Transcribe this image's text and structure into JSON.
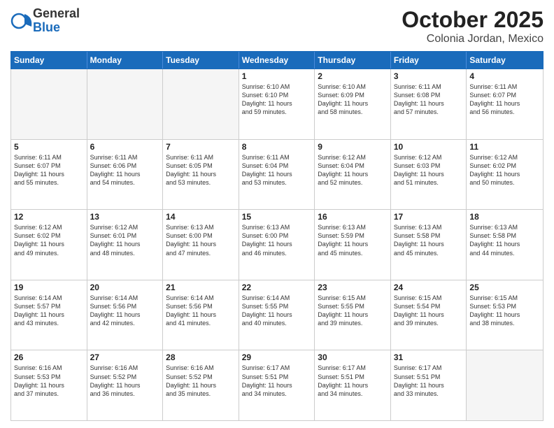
{
  "header": {
    "logo_general": "General",
    "logo_blue": "Blue",
    "month": "October 2025",
    "location": "Colonia Jordan, Mexico"
  },
  "weekdays": [
    "Sunday",
    "Monday",
    "Tuesday",
    "Wednesday",
    "Thursday",
    "Friday",
    "Saturday"
  ],
  "rows": [
    [
      {
        "day": "",
        "info": "",
        "empty": true
      },
      {
        "day": "",
        "info": "",
        "empty": true
      },
      {
        "day": "",
        "info": "",
        "empty": true
      },
      {
        "day": "1",
        "info": "Sunrise: 6:10 AM\nSunset: 6:10 PM\nDaylight: 11 hours\nand 59 minutes.",
        "empty": false
      },
      {
        "day": "2",
        "info": "Sunrise: 6:10 AM\nSunset: 6:09 PM\nDaylight: 11 hours\nand 58 minutes.",
        "empty": false
      },
      {
        "day": "3",
        "info": "Sunrise: 6:11 AM\nSunset: 6:08 PM\nDaylight: 11 hours\nand 57 minutes.",
        "empty": false
      },
      {
        "day": "4",
        "info": "Sunrise: 6:11 AM\nSunset: 6:07 PM\nDaylight: 11 hours\nand 56 minutes.",
        "empty": false
      }
    ],
    [
      {
        "day": "5",
        "info": "Sunrise: 6:11 AM\nSunset: 6:07 PM\nDaylight: 11 hours\nand 55 minutes.",
        "empty": false
      },
      {
        "day": "6",
        "info": "Sunrise: 6:11 AM\nSunset: 6:06 PM\nDaylight: 11 hours\nand 54 minutes.",
        "empty": false
      },
      {
        "day": "7",
        "info": "Sunrise: 6:11 AM\nSunset: 6:05 PM\nDaylight: 11 hours\nand 53 minutes.",
        "empty": false
      },
      {
        "day": "8",
        "info": "Sunrise: 6:11 AM\nSunset: 6:04 PM\nDaylight: 11 hours\nand 53 minutes.",
        "empty": false
      },
      {
        "day": "9",
        "info": "Sunrise: 6:12 AM\nSunset: 6:04 PM\nDaylight: 11 hours\nand 52 minutes.",
        "empty": false
      },
      {
        "day": "10",
        "info": "Sunrise: 6:12 AM\nSunset: 6:03 PM\nDaylight: 11 hours\nand 51 minutes.",
        "empty": false
      },
      {
        "day": "11",
        "info": "Sunrise: 6:12 AM\nSunset: 6:02 PM\nDaylight: 11 hours\nand 50 minutes.",
        "empty": false
      }
    ],
    [
      {
        "day": "12",
        "info": "Sunrise: 6:12 AM\nSunset: 6:02 PM\nDaylight: 11 hours\nand 49 minutes.",
        "empty": false
      },
      {
        "day": "13",
        "info": "Sunrise: 6:12 AM\nSunset: 6:01 PM\nDaylight: 11 hours\nand 48 minutes.",
        "empty": false
      },
      {
        "day": "14",
        "info": "Sunrise: 6:13 AM\nSunset: 6:00 PM\nDaylight: 11 hours\nand 47 minutes.",
        "empty": false
      },
      {
        "day": "15",
        "info": "Sunrise: 6:13 AM\nSunset: 6:00 PM\nDaylight: 11 hours\nand 46 minutes.",
        "empty": false
      },
      {
        "day": "16",
        "info": "Sunrise: 6:13 AM\nSunset: 5:59 PM\nDaylight: 11 hours\nand 45 minutes.",
        "empty": false
      },
      {
        "day": "17",
        "info": "Sunrise: 6:13 AM\nSunset: 5:58 PM\nDaylight: 11 hours\nand 45 minutes.",
        "empty": false
      },
      {
        "day": "18",
        "info": "Sunrise: 6:13 AM\nSunset: 5:58 PM\nDaylight: 11 hours\nand 44 minutes.",
        "empty": false
      }
    ],
    [
      {
        "day": "19",
        "info": "Sunrise: 6:14 AM\nSunset: 5:57 PM\nDaylight: 11 hours\nand 43 minutes.",
        "empty": false
      },
      {
        "day": "20",
        "info": "Sunrise: 6:14 AM\nSunset: 5:56 PM\nDaylight: 11 hours\nand 42 minutes.",
        "empty": false
      },
      {
        "day": "21",
        "info": "Sunrise: 6:14 AM\nSunset: 5:56 PM\nDaylight: 11 hours\nand 41 minutes.",
        "empty": false
      },
      {
        "day": "22",
        "info": "Sunrise: 6:14 AM\nSunset: 5:55 PM\nDaylight: 11 hours\nand 40 minutes.",
        "empty": false
      },
      {
        "day": "23",
        "info": "Sunrise: 6:15 AM\nSunset: 5:55 PM\nDaylight: 11 hours\nand 39 minutes.",
        "empty": false
      },
      {
        "day": "24",
        "info": "Sunrise: 6:15 AM\nSunset: 5:54 PM\nDaylight: 11 hours\nand 39 minutes.",
        "empty": false
      },
      {
        "day": "25",
        "info": "Sunrise: 6:15 AM\nSunset: 5:53 PM\nDaylight: 11 hours\nand 38 minutes.",
        "empty": false
      }
    ],
    [
      {
        "day": "26",
        "info": "Sunrise: 6:16 AM\nSunset: 5:53 PM\nDaylight: 11 hours\nand 37 minutes.",
        "empty": false
      },
      {
        "day": "27",
        "info": "Sunrise: 6:16 AM\nSunset: 5:52 PM\nDaylight: 11 hours\nand 36 minutes.",
        "empty": false
      },
      {
        "day": "28",
        "info": "Sunrise: 6:16 AM\nSunset: 5:52 PM\nDaylight: 11 hours\nand 35 minutes.",
        "empty": false
      },
      {
        "day": "29",
        "info": "Sunrise: 6:17 AM\nSunset: 5:51 PM\nDaylight: 11 hours\nand 34 minutes.",
        "empty": false
      },
      {
        "day": "30",
        "info": "Sunrise: 6:17 AM\nSunset: 5:51 PM\nDaylight: 11 hours\nand 34 minutes.",
        "empty": false
      },
      {
        "day": "31",
        "info": "Sunrise: 6:17 AM\nSunset: 5:51 PM\nDaylight: 11 hours\nand 33 minutes.",
        "empty": false
      },
      {
        "day": "",
        "info": "",
        "empty": true
      }
    ]
  ]
}
